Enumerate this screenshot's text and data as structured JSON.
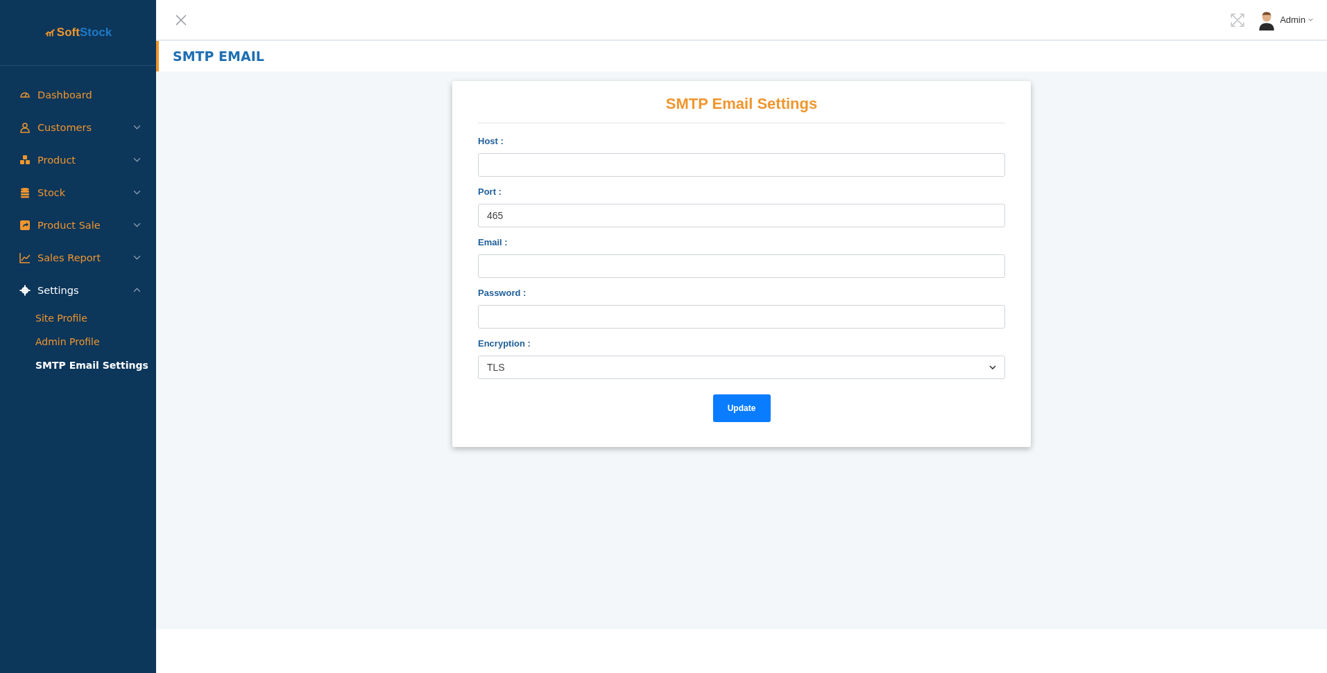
{
  "sidebar": {
    "logo": {
      "part_1": "Soft",
      "part_2": "Stock"
    },
    "items": [
      {
        "label": "Dashboard",
        "selected": false
      },
      {
        "label": "Customers",
        "selected": false,
        "expanded": false
      },
      {
        "label": "Product",
        "selected": false,
        "expanded": false
      },
      {
        "label": "Stock",
        "selected": false,
        "expanded": false
      },
      {
        "label": "Product Sale",
        "selected": false,
        "expanded": false
      },
      {
        "label": "Sales Report",
        "selected": false,
        "expanded": false
      },
      {
        "label": "Settings",
        "selected": true,
        "expanded": true,
        "children": [
          {
            "label": "Site Profile",
            "selected": false
          },
          {
            "label": "Admin Profile",
            "selected": false
          },
          {
            "label": "SMTP Email Settings",
            "selected": true
          }
        ]
      }
    ]
  },
  "topbar": {
    "user": "Admin"
  },
  "page_title": "SMTP EMAIL",
  "card": {
    "title": "SMTP Email Settings",
    "fields": [
      {
        "kind": "text",
        "label": "Host :"
      },
      {
        "kind": "text",
        "label": "Port :",
        "value": "465"
      },
      {
        "kind": "text",
        "label": "Email :"
      },
      {
        "kind": "text",
        "label": "Password :"
      },
      {
        "kind": "select",
        "label": "Encryption :",
        "value": "TLS"
      }
    ],
    "button": "Update"
  }
}
